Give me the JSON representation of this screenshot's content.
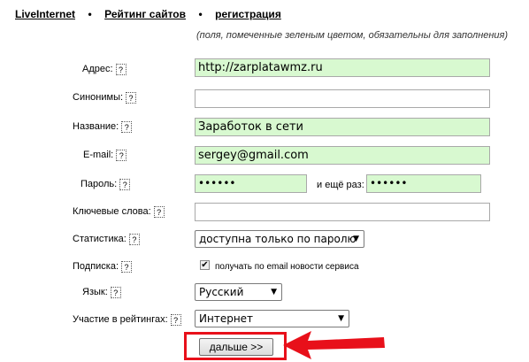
{
  "nav": {
    "items": [
      "LiveInternet",
      "Рейтинг сайтов",
      "регистрация"
    ],
    "separator": "•"
  },
  "note": "(поля, помеченные зеленым цветом, обязательны для заполнения)",
  "help_glyph": "?",
  "form": {
    "address": {
      "label": "Адрес:",
      "value": "http://zarplatawmz.ru",
      "required": true
    },
    "synonyms": {
      "label": "Синонимы:",
      "value": ""
    },
    "title": {
      "label": "Название:",
      "value": "Заработок в сети",
      "required": true
    },
    "email": {
      "label": "E-mail:",
      "value": "sergey@gmail.com",
      "required": true
    },
    "password": {
      "label": "Пароль:",
      "value": "••••••",
      "repeat_label": "и ещё раз:",
      "repeat_value": "••••••",
      "required": true
    },
    "keywords": {
      "label": "Ключевые слова:",
      "value": ""
    },
    "statistics": {
      "label": "Статистика:",
      "selected": "доступна только по паролю"
    },
    "subscription": {
      "label": "Подписка:",
      "checkbox_label": "получать по email новости сервиса",
      "checked": true
    },
    "language": {
      "label": "Язык:",
      "selected": "Русский"
    },
    "ratings": {
      "label": "Участие в рейтингах:",
      "selected": "Интернет"
    }
  },
  "submit_label": "дальше >>",
  "colors": {
    "required_bg": "#d8f9d0",
    "highlight": "#e8101a"
  },
  "annotation": {
    "type": "arrow",
    "color": "#e8101a"
  }
}
